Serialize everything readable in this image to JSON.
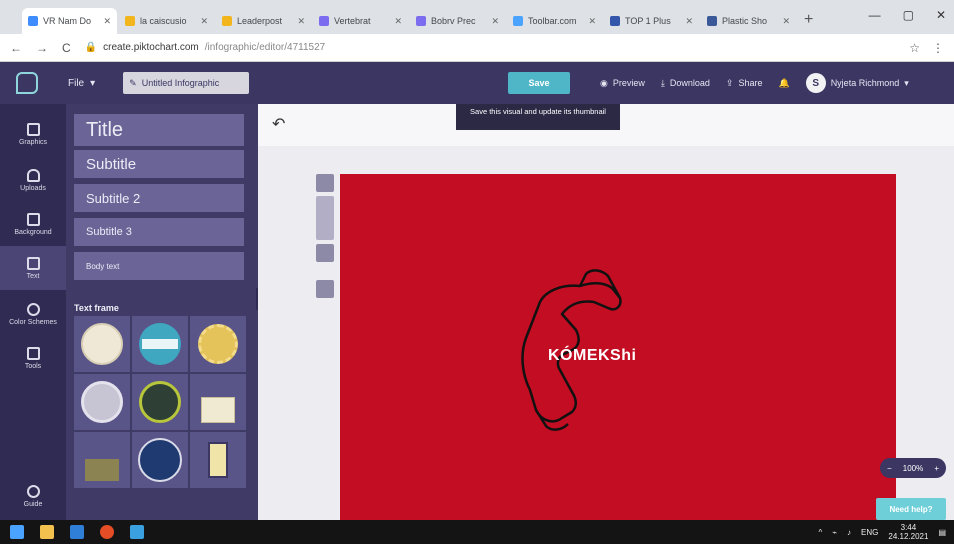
{
  "browser": {
    "tabs": [
      {
        "label": "VR Nam Do",
        "color": "#3f8cff"
      },
      {
        "label": "la caiscusio",
        "color": "#f2b51c"
      },
      {
        "label": "Leaderpost",
        "color": "#f2b51c"
      },
      {
        "label": "Vertebrat",
        "color": "#7b6cf0"
      },
      {
        "label": "Bobrv Prec",
        "color": "#7b6cf0"
      },
      {
        "label": "Toolbar.com",
        "color": "#4aa3ff"
      },
      {
        "label": "TOP 1 Plus",
        "color": "#3355aa"
      },
      {
        "label": "Plastic Sho",
        "color": "#3b5998"
      }
    ],
    "new_tab": "+",
    "window_controls": [
      "—",
      "▢",
      "✕"
    ],
    "nav_back": "←",
    "nav_forward": "→",
    "nav_reload": "C",
    "url_host": "create.piktochart.com",
    "url_path": "/infographic/editor/4711527",
    "ext_star": "☆",
    "ext_menu": "⋮"
  },
  "appbar": {
    "file_label": "File",
    "file_caret": "▾",
    "title_value": "Untitled Infographic",
    "save_label": "Save",
    "preview_label": "Preview",
    "download_label": "Download",
    "share_label": "Share",
    "user_initial": "S",
    "user_name": "Nyjeta Richmond"
  },
  "rail": {
    "items": [
      {
        "label": "Graphics"
      },
      {
        "label": "Uploads"
      },
      {
        "label": "Background"
      },
      {
        "label": "Text"
      },
      {
        "label": "Color Schemes"
      },
      {
        "label": "Tools"
      }
    ],
    "help_label": "Guide"
  },
  "text_panel": {
    "title": "Title",
    "subtitle": "Subtitle",
    "subtitle2": "Subtitle 2",
    "subtitle3": "Subtitle 3",
    "body": "Body text",
    "frames_label": "Text frame",
    "collapse": "‹"
  },
  "editor": {
    "undo": "↶",
    "tooltip": "Save this visual and update its thumbnail",
    "brand_text": "KÓMEKShi",
    "canvas_color": "#c20d22",
    "zoom_minus": "−",
    "zoom_value": "100%",
    "zoom_plus": "+",
    "help_button": "Need help?"
  },
  "taskbar": {
    "time": "3:44",
    "date": "24.12.2021",
    "lang": "ENG"
  }
}
